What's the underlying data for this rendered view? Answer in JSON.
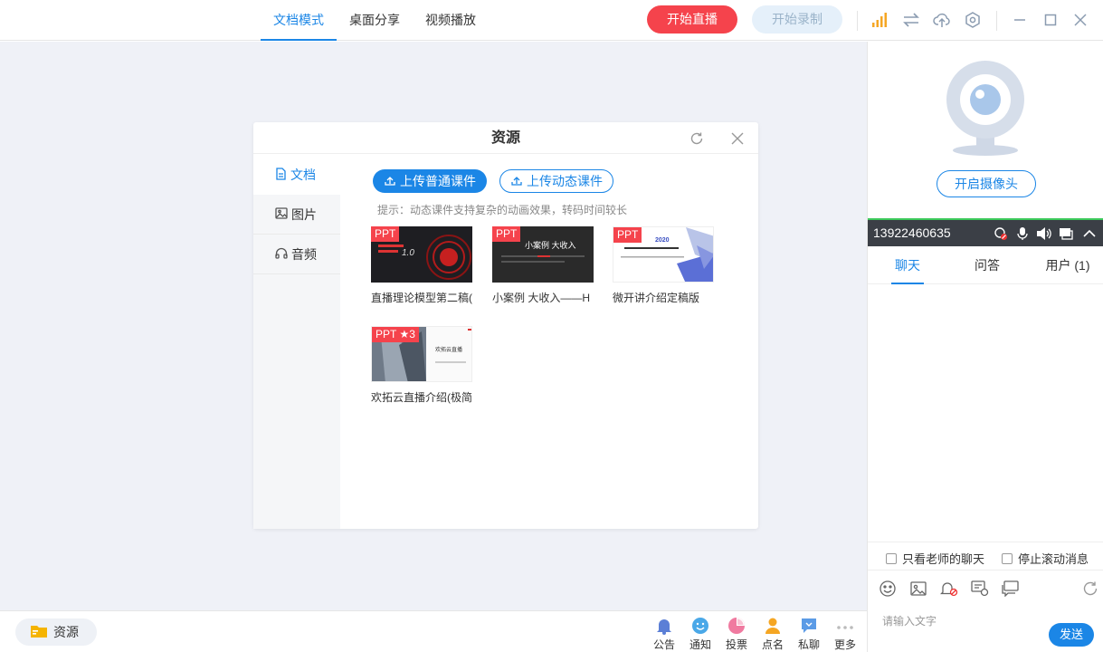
{
  "modes": [
    "文档模式",
    "桌面分享",
    "视频播放"
  ],
  "top": {
    "live_btn": "开始直播",
    "record_btn": "开始录制"
  },
  "dialog": {
    "title": "资源",
    "tabs": [
      "文档",
      "图片",
      "音频"
    ],
    "upload_normal": "上传普通课件",
    "upload_dynamic": "上传动态课件",
    "tip": "提示：动态课件支持复杂的动画效果，转码时间较长",
    "files": [
      {
        "badge": "PPT",
        "name": "直播理论模型第二稿(",
        "thumb_text": "1.0"
      },
      {
        "badge": "PPT",
        "name": "小案例 大收入——H",
        "thumb_text": "小案例 大收入"
      },
      {
        "badge": "PPT",
        "name": "微开讲介绍定稿版",
        "thumb_text": "2020"
      },
      {
        "badge": "PPT ★3",
        "name": "欢拓云直播介绍(极简",
        "thumb_text": "欢拓云直播"
      }
    ]
  },
  "bottom": {
    "resource_btn": "资源",
    "tools": [
      "公告",
      "通知",
      "投票",
      "点名",
      "私聊",
      "更多"
    ]
  },
  "right": {
    "camera_btn": "开启摄像头",
    "phone": "13922460635",
    "chat_tabs": [
      "聊天",
      "问答",
      "用户 (1)"
    ],
    "opt_teacher_only": "只看老师的聊天",
    "opt_stop_scroll": "停止滚动消息",
    "input_placeholder": "请输入文字",
    "send_btn": "发送"
  },
  "colors": {
    "accent": "#1b86e6",
    "live": "#f5434c",
    "signal": "#f5a623"
  }
}
